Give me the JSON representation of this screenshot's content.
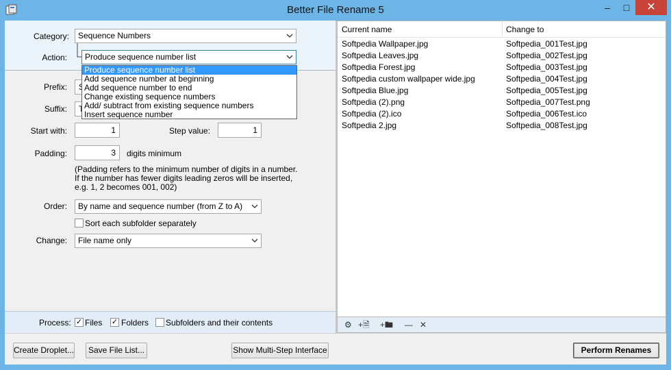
{
  "window": {
    "title": "Better File Rename 5",
    "minimize_icon": "minimize-icon",
    "maximize_icon": "maximize-icon",
    "close_icon": "close-icon",
    "close_color": "#c7433a",
    "accent_color": "#6cb5e6"
  },
  "form": {
    "category_label": "Category:",
    "category_value": "Sequence Numbers",
    "action_label": "Action:",
    "action_value": "Produce sequence number list",
    "action_options": [
      "Produce sequence number list",
      "Add sequence number at beginning",
      "Add sequence number to end",
      "Change existing sequence numbers",
      "Add/ subtract from existing sequence numbers",
      "Insert sequence number"
    ],
    "prefix_label": "Prefix:",
    "prefix_value": "S",
    "suffix_label": "Suffix:",
    "suffix_value": "T",
    "start_label": "Start with:",
    "start_value": "1",
    "step_label": "Step value:",
    "step_value": "1",
    "padding_label": "Padding:",
    "padding_value": "3",
    "padding_suffix": "digits minimum",
    "padding_note_1": "(Padding refers to the minimum number of digits in a number.",
    "padding_note_2": "If the number has fewer digits leading zeros will be inserted,",
    "padding_note_3": "e.g. 1, 2 becomes 001, 002)",
    "order_label": "Order:",
    "order_value": "By name and sequence number (from Z to A)",
    "subfolder_label": "Sort each subfolder separately",
    "change_label": "Change:",
    "change_value": "File name only"
  },
  "process": {
    "label": "Process:",
    "files_label": "Files",
    "folders_label": "Folders",
    "subfolders_label": "Subfolders and their contents"
  },
  "file_list": {
    "col_current": "Current name",
    "col_change": "Change to",
    "rows": [
      {
        "current": "Softpedia Wallpaper.jpg",
        "change": "Softpedia_001Test.jpg"
      },
      {
        "current": "Softpedia Leaves.jpg",
        "change": "Softpedia_002Test.jpg"
      },
      {
        "current": "Softpedia Forest.jpg",
        "change": "Softpedia_003Test.jpg"
      },
      {
        "current": "Softpedia custom wallpaper wide.jpg",
        "change": "Softpedia_004Test.jpg"
      },
      {
        "current": "Softpedia Blue.jpg",
        "change": "Softpedia_005Test.jpg"
      },
      {
        "current": "Softpedia (2).png",
        "change": "Softpedia_007Test.png"
      },
      {
        "current": "Softpedia (2).ico",
        "change": "Softpedia_006Test.ico"
      },
      {
        "current": "Softpedia 2.jpg",
        "change": "Softpedia_008Test.jpg"
      }
    ]
  },
  "toolbar": {
    "settings_icon": "gear-icon",
    "add_file_icon": "add-file-icon",
    "add_folder_icon": "add-folder-icon",
    "remove_icon": "minus-icon",
    "clear_icon": "close-icon"
  },
  "buttons": {
    "create_droplet": "Create Droplet...",
    "save_file_list": "Save File List...",
    "multi_step": "Show Multi-Step Interface",
    "perform": "Perform Renames"
  }
}
